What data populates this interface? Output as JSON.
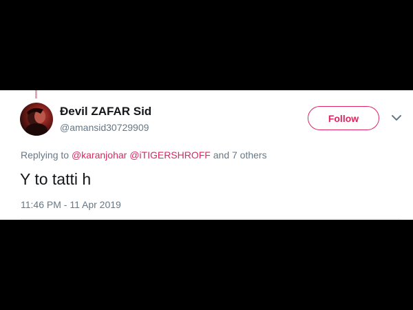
{
  "tweet": {
    "display_name": "Ɖevil ZAFAR Sid",
    "handle": "@amansid30729909",
    "follow_label": "Follow",
    "replying_prefix": "Replying to",
    "mentions": [
      "@karanjohar",
      "@iTIGERSHROFF"
    ],
    "replying_suffix": "and 7 others",
    "text": "Y to tatti h",
    "timestamp": "11:46 PM - 11 Apr 2019"
  },
  "colors": {
    "accent": "#e0245e",
    "secondary_text": "#657786",
    "primary_text": "#14171a",
    "backdrop": "#000000"
  },
  "icons": {
    "menu": "chevron-down-icon",
    "avatar": "user-avatar"
  }
}
